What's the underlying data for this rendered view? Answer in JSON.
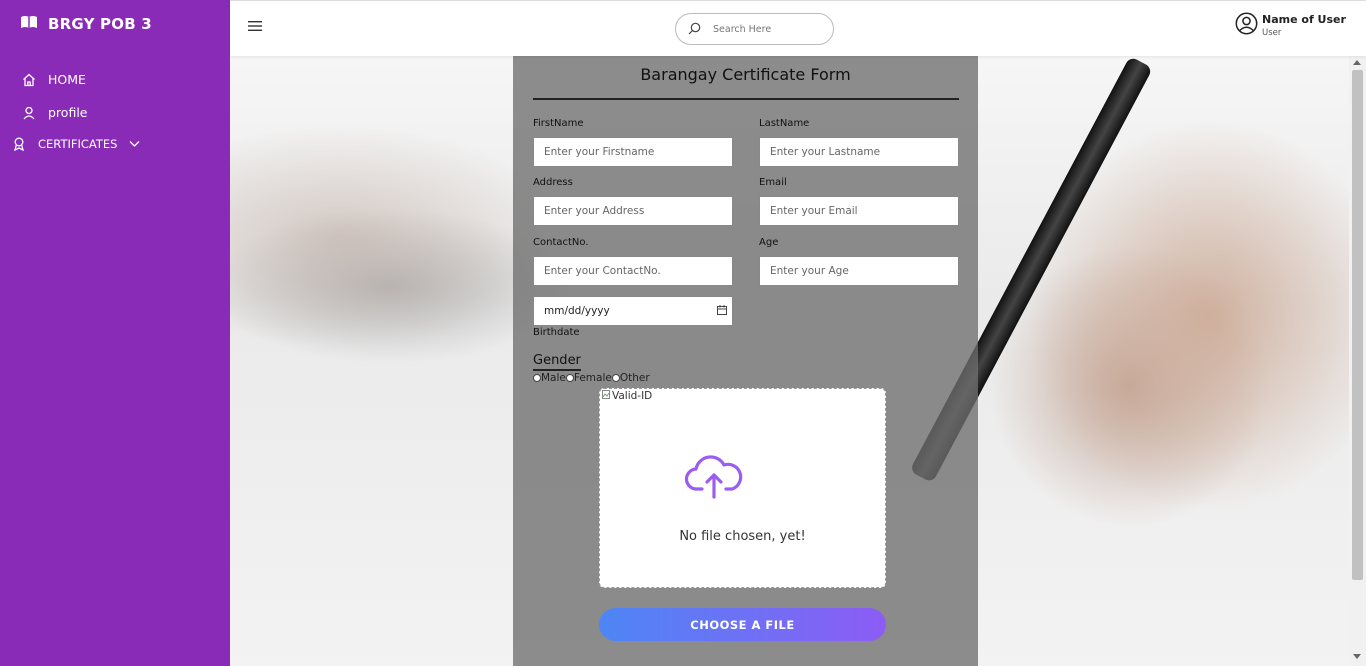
{
  "sidebar": {
    "brand": "BRGY POB 3",
    "items": [
      {
        "label": "HOME",
        "icon": "home-icon"
      },
      {
        "label": "profile",
        "icon": "user-icon"
      },
      {
        "label": "CERTIFICATES",
        "icon": "award-icon"
      }
    ]
  },
  "topbar": {
    "search_placeholder": "Search Here",
    "user_name": "Name of User",
    "user_role": "User"
  },
  "form": {
    "title": "Barangay Certificate Form",
    "fields": {
      "firstname": {
        "label": "FirstName",
        "placeholder": "Enter your Firstname"
      },
      "lastname": {
        "label": "LastName",
        "placeholder": "Enter your Lastname"
      },
      "address": {
        "label": "Address",
        "placeholder": "Enter your Address"
      },
      "email": {
        "label": "Email",
        "placeholder": "Enter your Email"
      },
      "contact": {
        "label": "ContactNo.",
        "placeholder": "Enter your ContactNo."
      },
      "age": {
        "label": "Age",
        "placeholder": "Enter your Age"
      },
      "birthdate": {
        "value": "mm/dd/yyyy",
        "label": "Birthdate"
      }
    },
    "gender": {
      "title": "Gender",
      "options": [
        "Male",
        "Female",
        "Other"
      ]
    },
    "upload": {
      "alt_text": "Valid-ID",
      "status": "No file chosen, yet!",
      "button": "CHOOSE A FILE"
    }
  },
  "colors": {
    "sidebar_bg": "#8a2bb8",
    "accent_start": "#4d86f5",
    "accent_end": "#8d5cf5",
    "cloud_icon": "#9b5cf0"
  }
}
